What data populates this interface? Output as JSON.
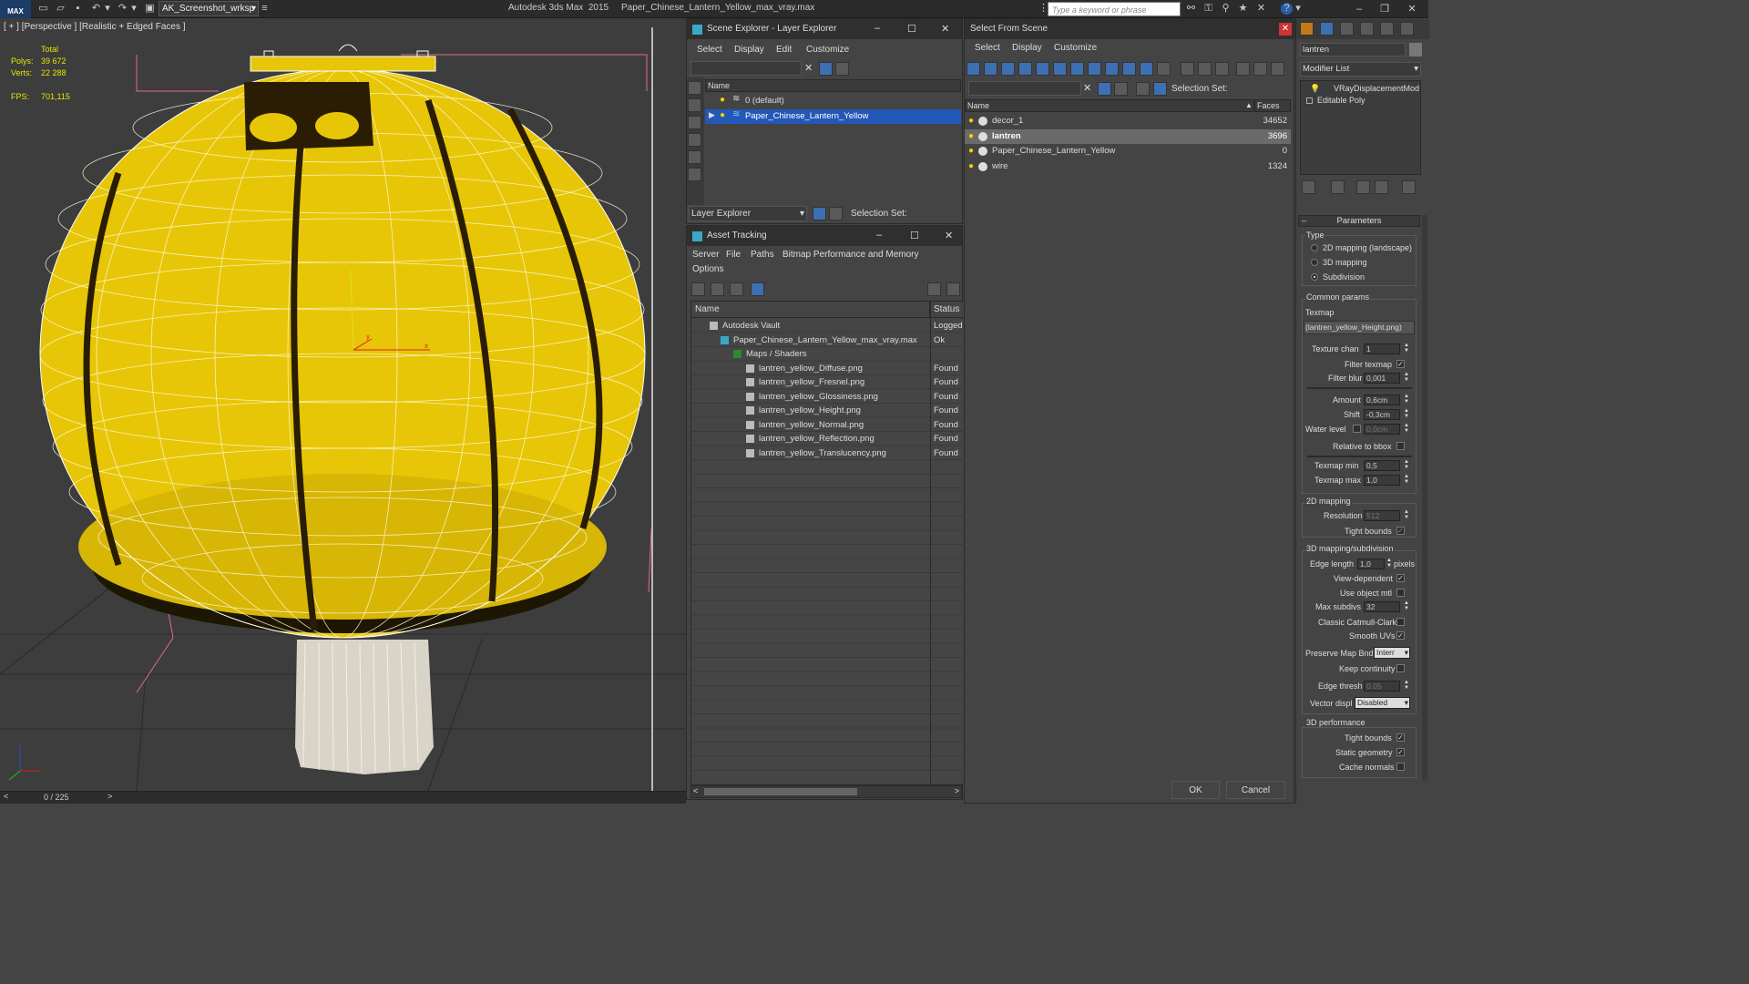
{
  "titlebar": {
    "app_logo": "MAX",
    "workspace": "AK_Screenshot_wrksp",
    "title": "Autodesk 3ds Max  2015     Paper_Chinese_Lantern_Yellow_max_vray.max",
    "search_placeholder": "Type a keyword or phrase"
  },
  "viewport": {
    "label": "[ + ] [Perspective ] [Realistic + Edged Faces ]",
    "stats": {
      "total_label": "Total",
      "polys_label": "Polys:",
      "polys_value": "39 672",
      "verts_label": "Verts:",
      "verts_value": "22 288",
      "fps_label": "FPS:",
      "fps_value": "701,115"
    },
    "timeline": "0 / 225",
    "gizmo": {
      "x": "x",
      "y": "y",
      "z": "z"
    }
  },
  "scene_explorer": {
    "title": "Scene Explorer - Layer Explorer",
    "menu": [
      "Select",
      "Display",
      "Edit",
      "Customize"
    ],
    "col_name": "Name",
    "rows": [
      "0 (default)",
      "Paper_Chinese_Lantern_Yellow"
    ],
    "footer_dropdown": "Layer Explorer",
    "selection_set_label": "Selection Set:"
  },
  "asset_tracking": {
    "title": "Asset Tracking",
    "menu": [
      "Server",
      "File",
      "Paths",
      "Bitmap Performance and Memory",
      "Options"
    ],
    "col_name": "Name",
    "col_status": "Status",
    "rows": [
      {
        "name": "Autodesk Vault",
        "status": "Logged"
      },
      {
        "name": "Paper_Chinese_Lantern_Yellow_max_vray.max",
        "status": "Ok"
      },
      {
        "name": "Maps / Shaders",
        "status": ""
      },
      {
        "name": "lantren_yellow_Diffuse.png",
        "status": "Found"
      },
      {
        "name": "lantren_yellow_Fresnel.png",
        "status": "Found"
      },
      {
        "name": "lantren_yellow_Glossiness.png",
        "status": "Found"
      },
      {
        "name": "lantren_yellow_Height.png",
        "status": "Found"
      },
      {
        "name": "lantren_yellow_Normal.png",
        "status": "Found"
      },
      {
        "name": "lantren_yellow_Reflection.png",
        "status": "Found"
      },
      {
        "name": "lantren_yellow_Translucency.png",
        "status": "Found"
      }
    ]
  },
  "select_from_scene": {
    "title": "Select From Scene",
    "menu": [
      "Select",
      "Display",
      "Customize"
    ],
    "selection_set_label": "Selection Set:",
    "col_name": "Name",
    "col_faces": "Faces",
    "rows": [
      {
        "name": "decor_1",
        "faces": "34652"
      },
      {
        "name": "lantren",
        "faces": "3696"
      },
      {
        "name": "Paper_Chinese_Lantern_Yellow",
        "faces": "0"
      },
      {
        "name": "wire",
        "faces": "1324"
      }
    ],
    "ok": "OK",
    "cancel": "Cancel"
  },
  "command_panel": {
    "object_name": "lantren",
    "modifier_list": "Modifier List",
    "stack": [
      "VRayDisplacementMod",
      "Editable Poly"
    ],
    "rollout": "Parameters",
    "type_label": "Type",
    "type_options": [
      "2D mapping (landscape)",
      "3D mapping",
      "Subdivision"
    ],
    "common_label": "Common params",
    "texmap_label": "Texmap",
    "texmap_value": "(lantren_yellow_Height.png)",
    "texture_chan_label": "Texture chan",
    "texture_chan_value": "1",
    "filter_texmap_label": "Filter texmap",
    "filter_blur_label": "Filter blur",
    "filter_blur_value": "0,001",
    "amount_label": "Amount",
    "amount_value": "0,6cm",
    "shift_label": "Shift",
    "shift_value": "-0,3cm",
    "water_label": "Water level",
    "water_value": "0,0cm",
    "relative_label": "Relative to bbox",
    "texmap_min_label": "Texmap min",
    "texmap_min_value": "0,5",
    "texmap_max_label": "Texmap max",
    "texmap_max_value": "1,0",
    "mapping2d_label": "2D mapping",
    "resolution_label": "Resolution",
    "resolution_value": "512",
    "tight_bounds_label": "Tight bounds",
    "mapping3d_label": "3D mapping/subdivision",
    "edge_length_label": "Edge length",
    "edge_length_value": "1,0",
    "pixels_label": "pixels",
    "view_dep_label": "View-dependent",
    "use_obj_label": "Use object mtl",
    "max_subdivs_label": "Max subdivs",
    "max_subdivs_value": "32",
    "catmull_label": "Classic Catmull-Clark",
    "smooth_uvs_label": "Smooth UVs",
    "preserve_label": "Preserve Map Bnd",
    "preserve_value": "Interr",
    "keep_cont_label": "Keep continuity",
    "edge_thresh_label": "Edge thresh",
    "edge_thresh_value": "0,05",
    "vector_label": "Vector displ",
    "vector_value": "Disabled",
    "perf_label": "3D performance",
    "perf_tight_label": "Tight bounds",
    "static_geo_label": "Static geometry",
    "cache_normals_label": "Cache normals"
  }
}
